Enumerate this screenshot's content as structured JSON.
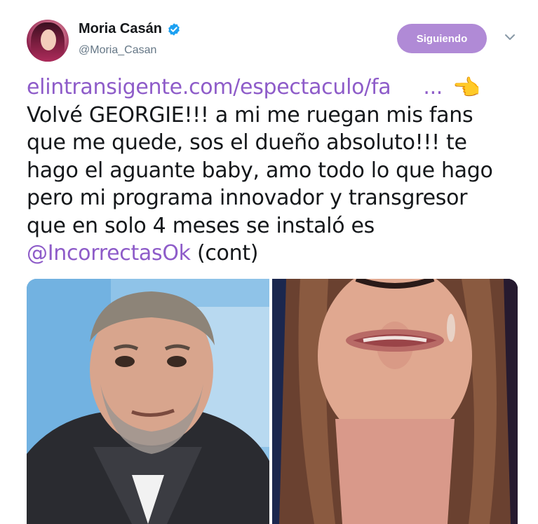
{
  "user": {
    "display_name": "Moria Casán",
    "handle": "@Moria_Casan",
    "verified": true
  },
  "follow_button": {
    "label": "Siguiendo"
  },
  "tweet": {
    "link_text": "elintransigente.com/espectaculo/fa",
    "link_ellipsis": "...",
    "pointing_emoji": "👈",
    "lines": [
      "Volvé GEORGIE!!! a mi me ruegan mis fans",
      "que me quede, sos el dueño absoluto!!! te",
      "hago el aguante baby, amo todo lo que hago",
      "pero mi programa innovador y transgresor",
      "que en solo 4 meses se instaló es"
    ],
    "mention": "@IncorrectasOk",
    "suffix": " (cont)"
  },
  "colors": {
    "accent": "#8e5cc9",
    "follow_bg": "#b08ad6",
    "verified": "#1da1f2",
    "text": "#14171a",
    "muted": "#657786"
  },
  "icons": {
    "verified": "verified-badge-icon",
    "chevron": "chevron-down-icon",
    "pointing": "pointing-left-emoji"
  }
}
